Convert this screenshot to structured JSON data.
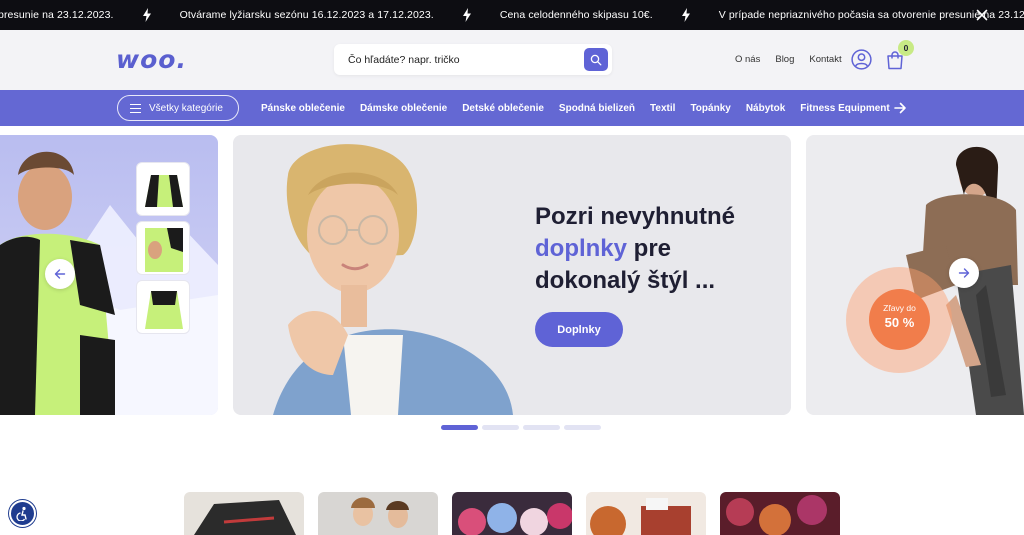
{
  "announcements": [
    "presunie na 23.12.2023.",
    "Otvárame lyžiarsku sezónu 16.12.2023 a 17.12.2023.",
    "Cena celodenného skipasu 10€.",
    "V prípade nepriaznivého počasia sa otvorenie presunie na 23.12"
  ],
  "header": {
    "logo": "woo.",
    "search": {
      "placeholder": "Čo hľadáte? napr. tričko"
    },
    "links": [
      "O nás",
      "Blog",
      "Kontakt"
    ],
    "cart_count": "0"
  },
  "nav": {
    "all_categories": "Všetky kategórie",
    "categories": [
      "Pánske oblečenie",
      "Dámske oblečenie",
      "Detské oblečenie",
      "Spodná bielizeň",
      "Textil",
      "Topánky",
      "Nábytok",
      "Fitness Equipment"
    ]
  },
  "hero": {
    "title_line1": "Pozri nevyhnutné",
    "title_accent": "doplnky",
    "title_line2_rest": " pre",
    "title_line3": "dokonalý štýl ...",
    "cta": "Doplnky",
    "promo_line1": "Zľavy do",
    "promo_line2": "50 %",
    "slide_count": 4,
    "active_slide": 0
  },
  "colors": {
    "brand": "#5f63d6",
    "nav_bg": "#6468d3",
    "topbar_bg": "#0d0d12",
    "badge": "#c8ea85",
    "promo": "#f17d4b"
  }
}
